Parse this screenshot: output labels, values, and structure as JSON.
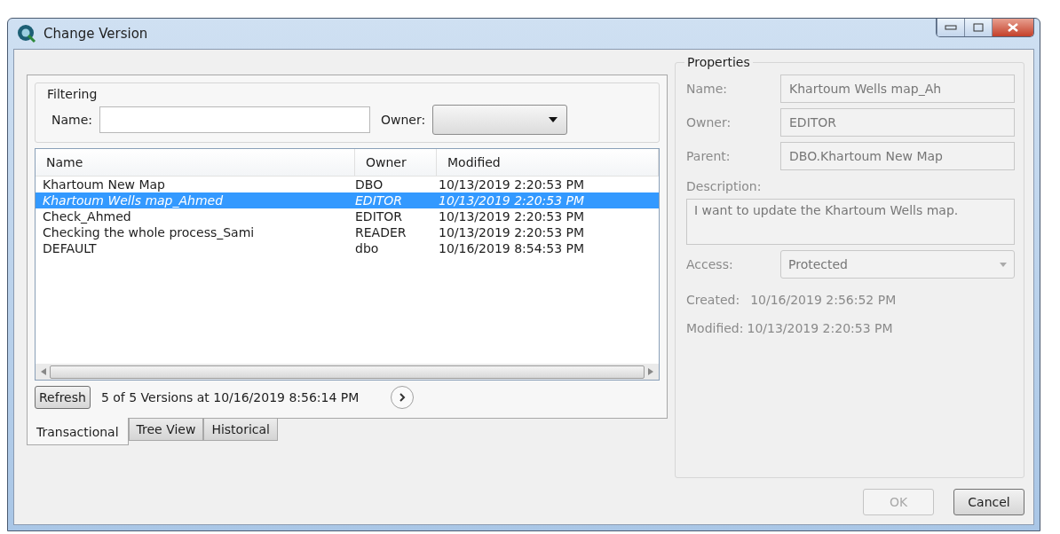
{
  "window": {
    "title": "Change Version"
  },
  "filtering": {
    "title": "Filtering",
    "name_label": "Name:",
    "owner_label": "Owner:"
  },
  "table": {
    "columns": [
      "Name",
      "Owner",
      "Modified"
    ],
    "rows": [
      {
        "cells": [
          "Khartoum New Map",
          "DBO",
          "10/13/2019 2:20:53 PM"
        ],
        "selected": false
      },
      {
        "cells": [
          "Khartoum Wells map_Ahmed",
          "EDITOR",
          "10/13/2019 2:20:53 PM"
        ],
        "selected": true
      },
      {
        "cells": [
          "Check_Ahmed",
          "EDITOR",
          "10/13/2019 2:20:53 PM"
        ],
        "selected": false
      },
      {
        "cells": [
          "Checking the whole process_Sami",
          "READER",
          "10/13/2019 2:20:53 PM"
        ],
        "selected": false
      },
      {
        "cells": [
          "DEFAULT",
          "dbo",
          "10/16/2019 8:54:53 PM"
        ],
        "selected": false
      }
    ]
  },
  "refresh_button": "Refresh",
  "status": "5 of 5 Versions at 10/16/2019 8:56:14 PM",
  "tabs": [
    {
      "label": "Transactional",
      "selected": true
    },
    {
      "label": "Tree View",
      "selected": false
    },
    {
      "label": "Historical",
      "selected": false
    }
  ],
  "properties": {
    "title": "Properties",
    "fields": [
      {
        "label": "Name:",
        "value": "Khartoum Wells map_Ah"
      },
      {
        "label": "Owner:",
        "value": "EDITOR"
      },
      {
        "label": "Parent:",
        "value": "DBO.Khartoum New Map"
      }
    ],
    "description_label": "Description:",
    "description": "I want to update the Khartoum Wells map.",
    "access_label": "Access:",
    "access": {
      "value": "Protected",
      "disabled": true
    },
    "created_label": "Created:",
    "created": "10/16/2019 2:56:52 PM",
    "modified_label": "Modified:",
    "modified": "10/13/2019 2:20:53 PM"
  },
  "buttons": [
    {
      "label": "OK",
      "disabled": true
    },
    {
      "label": "Cancel",
      "disabled": false
    }
  ]
}
